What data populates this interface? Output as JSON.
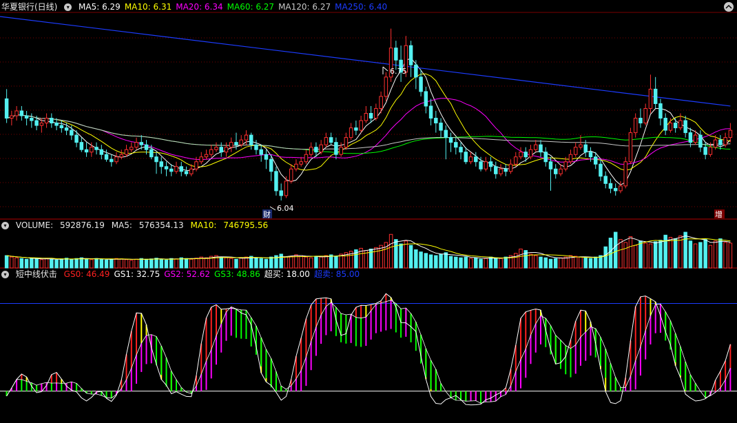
{
  "main_panel": {
    "title": "华夏银行(日线)",
    "indicators": [
      {
        "label": "MA5:",
        "value": "6.29",
        "color": "#ffffff"
      },
      {
        "label": "MA10:",
        "value": "6.31",
        "color": "#ffff00"
      },
      {
        "label": "MA20:",
        "value": "6.34",
        "color": "#ff00ff"
      },
      {
        "label": "MA60:",
        "value": "6.27",
        "color": "#00ff00"
      },
      {
        "label": "MA120:",
        "value": "6.27",
        "color": "#c8c8c8"
      },
      {
        "label": "MA250:",
        "value": "6.40",
        "color": "#1c3cff"
      }
    ],
    "high_marker": "6.75",
    "low_marker": "6.04",
    "badge_left": "财",
    "badge_right": "增"
  },
  "volume_panel": {
    "title": "VOLUME:",
    "value": "592876.19",
    "ma5_label": "MA5:",
    "ma5_value": "576354.13",
    "ma10_label": "MA10:",
    "ma10_value": "746795.56"
  },
  "indicator_panel": {
    "title": "短中线伏击",
    "items": [
      {
        "label": "GS0:",
        "value": "46.49",
        "color": "#ff2020"
      },
      {
        "label": "GS1:",
        "value": "32.75",
        "color": "#ffffff"
      },
      {
        "label": "GS2:",
        "value": "52.62",
        "color": "#ff00ff"
      },
      {
        "label": "GS3:",
        "value": "48.86",
        "color": "#00ff00"
      },
      {
        "label": "超买:",
        "value": "18.00",
        "color": "#ffffff"
      },
      {
        "label": "超卖:",
        "value": "85.00",
        "color": "#1c3cff"
      }
    ]
  },
  "colors": {
    "up": "#ff3030",
    "down": "#54f0f0",
    "ma5": "#ffffff",
    "ma10": "#ffff00",
    "ma20": "#ff00ff",
    "ma60": "#00ff00",
    "ma120": "#c8c8c8",
    "ma250": "#1c3cff",
    "grid": "#7a0000"
  },
  "chart_data": {
    "type": "candlestick",
    "price_range": [
      6.0,
      6.8
    ],
    "candles": [
      [
        6.46,
        6.38,
        6.5,
        6.36
      ],
      [
        6.38,
        6.39,
        6.41,
        6.35
      ],
      [
        6.39,
        6.41,
        6.43,
        6.37
      ],
      [
        6.41,
        6.39,
        6.43,
        6.37
      ],
      [
        6.39,
        6.38,
        6.41,
        6.35
      ],
      [
        6.38,
        6.37,
        6.4,
        6.34
      ],
      [
        6.37,
        6.35,
        6.39,
        6.33
      ],
      [
        6.35,
        6.36,
        6.38,
        6.32
      ],
      [
        6.36,
        6.38,
        6.4,
        6.34
      ],
      [
        6.38,
        6.36,
        6.4,
        6.34
      ],
      [
        6.36,
        6.35,
        6.38,
        6.33
      ],
      [
        6.35,
        6.34,
        6.37,
        6.32
      ],
      [
        6.34,
        6.33,
        6.36,
        6.31
      ],
      [
        6.33,
        6.31,
        6.35,
        6.29
      ],
      [
        6.31,
        6.28,
        6.33,
        6.26
      ],
      [
        6.28,
        6.25,
        6.3,
        6.24
      ],
      [
        6.25,
        6.24,
        6.28,
        6.22
      ],
      [
        6.24,
        6.26,
        6.28,
        6.22
      ],
      [
        6.26,
        6.25,
        6.28,
        6.23
      ],
      [
        6.25,
        6.23,
        6.27,
        6.21
      ],
      [
        6.23,
        6.21,
        6.25,
        6.2
      ],
      [
        6.21,
        6.2,
        6.23,
        6.18
      ],
      [
        6.2,
        6.22,
        6.24,
        6.19
      ],
      [
        6.22,
        6.23,
        6.25,
        6.21
      ],
      [
        6.23,
        6.25,
        6.27,
        6.22
      ],
      [
        6.25,
        6.26,
        6.28,
        6.24
      ],
      [
        6.26,
        6.28,
        6.3,
        6.25
      ],
      [
        6.28,
        6.27,
        6.31,
        6.25
      ],
      [
        6.27,
        6.25,
        6.29,
        6.23
      ],
      [
        6.25,
        6.22,
        6.27,
        6.21
      ],
      [
        6.22,
        6.2,
        6.24,
        6.15
      ],
      [
        6.2,
        6.18,
        6.22,
        6.15
      ],
      [
        6.18,
        6.17,
        6.2,
        6.14
      ],
      [
        6.17,
        6.16,
        6.19,
        6.14
      ],
      [
        6.16,
        6.18,
        6.2,
        6.15
      ],
      [
        6.18,
        6.16,
        6.2,
        6.14
      ],
      [
        6.16,
        6.15,
        6.18,
        6.14
      ],
      [
        6.15,
        6.17,
        6.19,
        6.14
      ],
      [
        6.17,
        6.2,
        6.22,
        6.16
      ],
      [
        6.2,
        6.22,
        6.24,
        6.19
      ],
      [
        6.22,
        6.23,
        6.25,
        6.21
      ],
      [
        6.23,
        6.25,
        6.27,
        6.22
      ],
      [
        6.25,
        6.26,
        6.28,
        6.24
      ],
      [
        6.26,
        6.24,
        6.28,
        6.22
      ],
      [
        6.24,
        6.26,
        6.28,
        6.22
      ],
      [
        6.26,
        6.28,
        6.3,
        6.24
      ],
      [
        6.28,
        6.27,
        6.32,
        6.25
      ],
      [
        6.27,
        6.29,
        6.31,
        6.26
      ],
      [
        6.29,
        6.31,
        6.33,
        6.27
      ],
      [
        6.31,
        6.27,
        6.32,
        6.25
      ],
      [
        6.27,
        6.25,
        6.29,
        6.23
      ],
      [
        6.25,
        6.23,
        6.27,
        6.2
      ],
      [
        6.23,
        6.21,
        6.25,
        6.17
      ],
      [
        6.21,
        6.16,
        6.23,
        6.12
      ],
      [
        6.16,
        6.08,
        6.18,
        6.06
      ],
      [
        6.08,
        6.06,
        6.11,
        6.04
      ],
      [
        6.06,
        6.12,
        6.14,
        6.05
      ],
      [
        6.12,
        6.17,
        6.19,
        6.11
      ],
      [
        6.17,
        6.19,
        6.21,
        6.16
      ],
      [
        6.19,
        6.2,
        6.22,
        6.18
      ],
      [
        6.2,
        6.23,
        6.25,
        6.19
      ],
      [
        6.23,
        6.26,
        6.28,
        6.22
      ],
      [
        6.26,
        6.24,
        6.28,
        6.22
      ],
      [
        6.24,
        6.27,
        6.29,
        6.23
      ],
      [
        6.27,
        6.3,
        6.32,
        6.26
      ],
      [
        6.3,
        6.28,
        6.32,
        6.27
      ],
      [
        6.28,
        6.23,
        6.3,
        6.21
      ],
      [
        6.23,
        6.26,
        6.28,
        6.22
      ],
      [
        6.26,
        6.3,
        6.32,
        6.25
      ],
      [
        6.3,
        6.34,
        6.36,
        6.29
      ],
      [
        6.34,
        6.33,
        6.37,
        6.31
      ],
      [
        6.33,
        6.37,
        6.39,
        6.32
      ],
      [
        6.37,
        6.4,
        6.43,
        6.36
      ],
      [
        6.4,
        6.38,
        6.43,
        6.36
      ],
      [
        6.38,
        6.42,
        6.44,
        6.37
      ],
      [
        6.42,
        6.47,
        6.49,
        6.4
      ],
      [
        6.47,
        6.55,
        6.57,
        6.45
      ],
      [
        6.55,
        6.67,
        6.75,
        6.53
      ],
      [
        6.67,
        6.62,
        6.7,
        6.58
      ],
      [
        6.62,
        6.57,
        6.68,
        6.53
      ],
      [
        6.57,
        6.68,
        6.72,
        6.55
      ],
      [
        6.68,
        6.6,
        6.7,
        6.55
      ],
      [
        6.6,
        6.55,
        6.62,
        6.5
      ],
      [
        6.55,
        6.49,
        6.58,
        6.47
      ],
      [
        6.49,
        6.43,
        6.51,
        6.4
      ],
      [
        6.43,
        6.38,
        6.46,
        6.35
      ],
      [
        6.38,
        6.36,
        6.41,
        6.32
      ],
      [
        6.36,
        6.33,
        6.38,
        6.3
      ],
      [
        6.33,
        6.3,
        6.35,
        6.21
      ],
      [
        6.3,
        6.28,
        6.32,
        6.24
      ],
      [
        6.28,
        6.26,
        6.3,
        6.23
      ],
      [
        6.26,
        6.24,
        6.28,
        6.21
      ],
      [
        6.24,
        6.2,
        6.26,
        6.19
      ],
      [
        6.2,
        6.22,
        6.24,
        6.19
      ],
      [
        6.22,
        6.2,
        6.24,
        6.18
      ],
      [
        6.2,
        6.17,
        6.22,
        6.16
      ],
      [
        6.17,
        6.2,
        6.22,
        6.16
      ],
      [
        6.2,
        6.18,
        6.22,
        6.16
      ],
      [
        6.18,
        6.15,
        6.2,
        6.13
      ],
      [
        6.15,
        6.17,
        6.19,
        6.14
      ],
      [
        6.17,
        6.16,
        6.19,
        6.14
      ],
      [
        6.16,
        6.19,
        6.21,
        6.15
      ],
      [
        6.19,
        6.22,
        6.24,
        6.18
      ],
      [
        6.22,
        6.24,
        6.26,
        6.21
      ],
      [
        6.24,
        6.22,
        6.26,
        6.2
      ],
      [
        6.22,
        6.25,
        6.27,
        6.21
      ],
      [
        6.25,
        6.27,
        6.29,
        6.24
      ],
      [
        6.27,
        6.24,
        6.29,
        6.22
      ],
      [
        6.24,
        6.2,
        6.26,
        6.18
      ],
      [
        6.2,
        6.17,
        6.22,
        6.08
      ],
      [
        6.17,
        6.15,
        6.19,
        6.13
      ],
      [
        6.15,
        6.17,
        6.19,
        6.14
      ],
      [
        6.17,
        6.2,
        6.22,
        6.16
      ],
      [
        6.2,
        6.23,
        6.25,
        6.19
      ],
      [
        6.23,
        6.26,
        6.28,
        6.22
      ],
      [
        6.26,
        6.27,
        6.31,
        6.25
      ],
      [
        6.27,
        6.24,
        6.29,
        6.22
      ],
      [
        6.24,
        6.22,
        6.26,
        6.2
      ],
      [
        6.22,
        6.19,
        6.24,
        6.17
      ],
      [
        6.19,
        6.14,
        6.21,
        6.12
      ],
      [
        6.14,
        6.11,
        6.16,
        6.09
      ],
      [
        6.11,
        6.09,
        6.13,
        6.07
      ],
      [
        6.09,
        6.08,
        6.11,
        6.06
      ],
      [
        6.08,
        6.1,
        6.12,
        6.07
      ],
      [
        6.1,
        6.2,
        6.22,
        6.09
      ],
      [
        6.2,
        6.32,
        6.34,
        6.19
      ],
      [
        6.32,
        6.38,
        6.4,
        6.3
      ],
      [
        6.38,
        6.36,
        6.42,
        6.34
      ],
      [
        6.36,
        6.42,
        6.44,
        6.35
      ],
      [
        6.42,
        6.5,
        6.56,
        6.4
      ],
      [
        6.5,
        6.44,
        6.55,
        6.42
      ],
      [
        6.44,
        6.38,
        6.46,
        6.35
      ],
      [
        6.38,
        6.33,
        6.4,
        6.31
      ],
      [
        6.33,
        6.36,
        6.38,
        6.32
      ],
      [
        6.36,
        6.34,
        6.38,
        6.32
      ],
      [
        6.34,
        6.37,
        6.4,
        6.33
      ],
      [
        6.37,
        6.32,
        6.39,
        6.3
      ],
      [
        6.32,
        6.28,
        6.34,
        6.26
      ],
      [
        6.28,
        6.31,
        6.33,
        6.27
      ],
      [
        6.31,
        6.26,
        6.33,
        6.24
      ],
      [
        6.26,
        6.23,
        6.28,
        6.21
      ],
      [
        6.23,
        6.26,
        6.28,
        6.22
      ],
      [
        6.26,
        6.29,
        6.31,
        6.25
      ],
      [
        6.29,
        6.27,
        6.31,
        6.25
      ],
      [
        6.27,
        6.3,
        6.32,
        6.26
      ],
      [
        6.3,
        6.33,
        6.36,
        6.28
      ]
    ],
    "volumes": [
      0.34,
      0.3,
      0.28,
      0.26,
      0.24,
      0.27,
      0.25,
      0.23,
      0.26,
      0.24,
      0.22,
      0.25,
      0.27,
      0.24,
      0.26,
      0.28,
      0.25,
      0.23,
      0.26,
      0.24,
      0.22,
      0.24,
      0.26,
      0.25,
      0.23,
      0.21,
      0.24,
      0.26,
      0.24,
      0.25,
      0.27,
      0.24,
      0.22,
      0.26,
      0.25,
      0.28,
      0.26,
      0.24,
      0.27,
      0.3,
      0.28,
      0.32,
      0.34,
      0.3,
      0.28,
      0.26,
      0.24,
      0.27,
      0.3,
      0.32,
      0.28,
      0.26,
      0.24,
      0.3,
      0.34,
      0.38,
      0.3,
      0.32,
      0.36,
      0.34,
      0.3,
      0.28,
      0.32,
      0.3,
      0.34,
      0.36,
      0.32,
      0.38,
      0.42,
      0.46,
      0.5,
      0.54,
      0.48,
      0.52,
      0.56,
      0.62,
      0.7,
      0.92,
      0.78,
      0.66,
      0.74,
      0.62,
      0.5,
      0.44,
      0.4,
      0.36,
      0.34,
      0.38,
      0.42,
      0.32,
      0.3,
      0.28,
      0.3,
      0.26,
      0.28,
      0.24,
      0.26,
      0.3,
      0.28,
      0.26,
      0.3,
      0.34,
      0.4,
      0.52,
      0.48,
      0.38,
      0.34,
      0.3,
      0.28,
      0.24,
      0.26,
      0.28,
      0.3,
      0.34,
      0.32,
      0.3,
      0.28,
      0.26,
      0.3,
      0.34,
      0.58,
      0.82,
      0.98,
      0.78,
      0.7,
      0.86,
      0.62,
      0.74,
      0.68,
      0.66,
      0.72,
      0.76,
      0.9,
      0.84,
      0.8,
      0.88,
      0.98,
      0.74,
      0.66,
      0.7,
      0.78,
      0.62,
      0.74,
      0.8,
      0.7,
      0.68
    ],
    "high_label": "6.75",
    "low_label": "6.04",
    "indicator": {
      "overbought": 18.0,
      "oversold": 85.0
    }
  }
}
